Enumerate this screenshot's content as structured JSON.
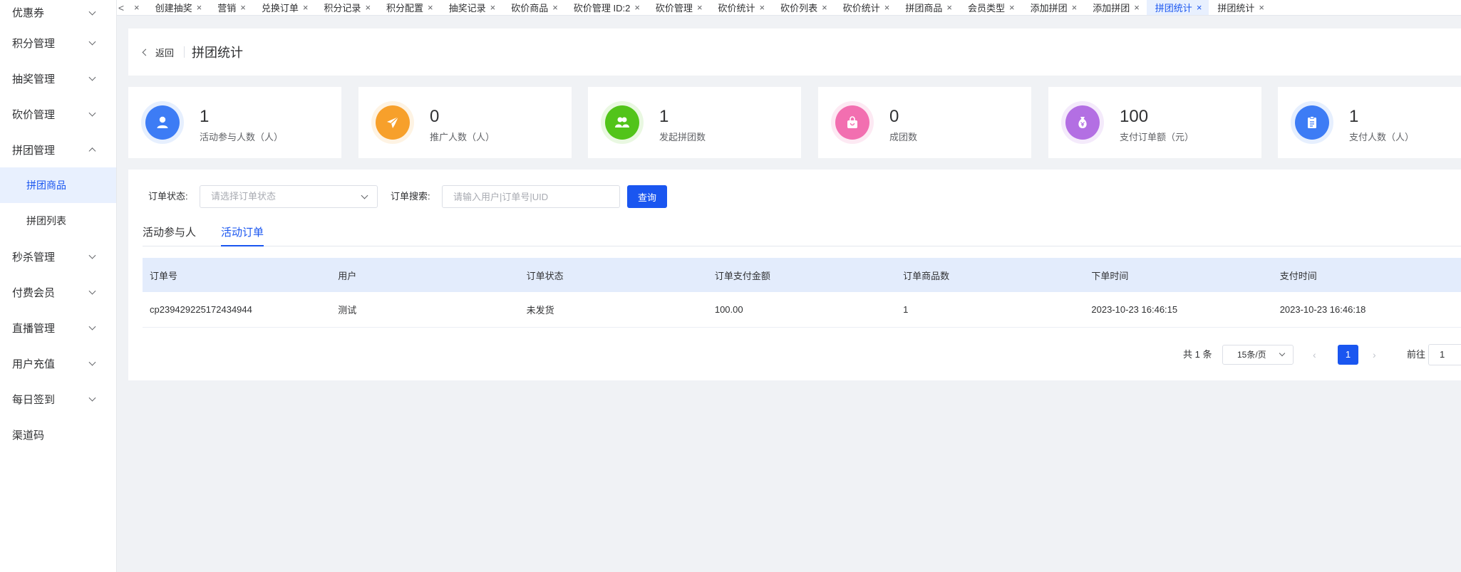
{
  "sidebar": {
    "items": [
      {
        "label": "优惠券",
        "expand": "down"
      },
      {
        "label": "积分管理",
        "expand": "down"
      },
      {
        "label": "抽奖管理",
        "expand": "down"
      },
      {
        "label": "砍价管理",
        "expand": "down"
      },
      {
        "label": "拼团管理",
        "expand": "up"
      },
      {
        "label": "拼团商品",
        "sub": true,
        "active": true
      },
      {
        "label": "拼团列表",
        "sub": true
      },
      {
        "label": "秒杀管理",
        "expand": "down"
      },
      {
        "label": "付费会员",
        "expand": "down"
      },
      {
        "label": "直播管理",
        "expand": "down"
      },
      {
        "label": "用户充值",
        "expand": "down"
      },
      {
        "label": "每日签到",
        "expand": "down"
      },
      {
        "label": "渠道码"
      }
    ]
  },
  "tabs": {
    "left_arrow": "<",
    "close_glyph": "×",
    "items": [
      {
        "label": "创建抽奖"
      },
      {
        "label": "营销"
      },
      {
        "label": "兑换订单"
      },
      {
        "label": "积分记录"
      },
      {
        "label": "积分配置"
      },
      {
        "label": "抽奖记录"
      },
      {
        "label": "砍价商品"
      },
      {
        "label": "砍价管理 ID:2"
      },
      {
        "label": "砍价管理"
      },
      {
        "label": "砍价统计"
      },
      {
        "label": "砍价列表"
      },
      {
        "label": "砍价统计"
      },
      {
        "label": "拼团商品"
      },
      {
        "label": "会员类型"
      },
      {
        "label": "添加拼团"
      },
      {
        "label": "添加拼团"
      },
      {
        "label": "拼团统计",
        "active": true
      },
      {
        "label": "拼团统计"
      }
    ]
  },
  "header": {
    "back_label": "返回",
    "title": "拼团统计"
  },
  "stats": [
    {
      "value": "1",
      "label": "活动参与人数（人）",
      "icon": "user-icon",
      "color": "#3d7cf5",
      "ring": "#e6effe"
    },
    {
      "value": "0",
      "label": "推广人数（人）",
      "icon": "paper-plane-icon",
      "color": "#f7a02b",
      "ring": "#fef3e3"
    },
    {
      "value": "1",
      "label": "发起拼团数",
      "icon": "group-icon",
      "color": "#52c41a",
      "ring": "#e9f8e1"
    },
    {
      "value": "0",
      "label": "成团数",
      "icon": "shopping-bag-icon",
      "color": "#f26fb0",
      "ring": "#fde9f3"
    },
    {
      "value": "100",
      "label": "支付订单额（元）",
      "icon": "money-bag-icon",
      "color": "#b36fe3",
      "ring": "#f4eafb"
    },
    {
      "value": "1",
      "label": "支付人数（人）",
      "icon": "clipboard-icon",
      "color": "#3d7cf5",
      "ring": "#e6effe"
    }
  ],
  "filters": {
    "status_label": "订单状态:",
    "status_placeholder": "请选择订单状态",
    "search_label": "订单搜索:",
    "search_placeholder": "请输入用户|订单号|UID",
    "query_button": "查询"
  },
  "subtabs": [
    {
      "label": "活动参与人"
    },
    {
      "label": "活动订单",
      "active": true
    }
  ],
  "table": {
    "columns": [
      "订单号",
      "用户",
      "订单状态",
      "订单支付金额",
      "订单商品数",
      "下单时间",
      "支付时间"
    ],
    "rows": [
      [
        "cp239429225172434944",
        "测试",
        "未发货",
        "100.00",
        "1",
        "2023-10-23 16:46:15",
        "2023-10-23 16:46:18"
      ]
    ]
  },
  "pagination": {
    "total": "共 1 条",
    "page_size": "15条/页",
    "prev": "‹",
    "next": "›",
    "current_page": "1",
    "goto_label": "前往",
    "goto_value": "1"
  }
}
